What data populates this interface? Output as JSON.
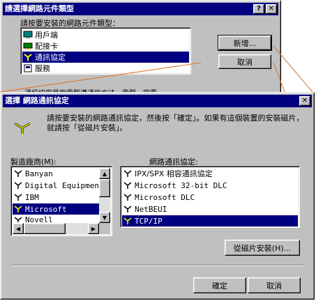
{
  "back_dialog": {
    "title": "請選擇網路元件類型",
    "help_btn": "?",
    "close_btn": "✕",
    "prompt": "請按要安裝的網路元件類型：",
    "items": [
      {
        "label": "用戶端",
        "icon": "client-icon"
      },
      {
        "label": "配接卡",
        "icon": "adapter-icon"
      },
      {
        "label": "通訊協定",
        "icon": "protocol-icon",
        "selected": true
      },
      {
        "label": "服務",
        "icon": "service-icon"
      }
    ],
    "add_button": "新增...",
    "cancel_button": "取消",
    "description": "通訊協定是指電腦溝通的方法。電腦一定要"
  },
  "front_dialog": {
    "title": "選擇 網路通訊協定",
    "close_btn": "✕",
    "instruction": "請按要安裝的網路通訊協定，然後按「確定」。如果有這個裝置的安裝磁片，就請按「從磁片安裝」。",
    "manufacturers_label": "製造廠商(M):",
    "manufacturers": [
      "Banyan",
      "Digital Equipment",
      "IBM",
      "Microsoft",
      "Novell"
    ],
    "selected_manufacturer": 3,
    "protocols_label": "網路通訊協定:",
    "protocols": [
      "IPX/SPX 相容通訊協定",
      "Microsoft 32-bit DLC",
      "Microsoft DLC",
      "NetBEUI",
      "TCP/IP"
    ],
    "selected_protocol": 4,
    "have_disk_button": "從磁片安裝(H)...",
    "ok_button": "確定",
    "cancel_button": "取消"
  },
  "colors": {
    "titlebar": "#000080",
    "face": "#c0c0c0",
    "selection": "#000080",
    "callout": "#e07020"
  }
}
